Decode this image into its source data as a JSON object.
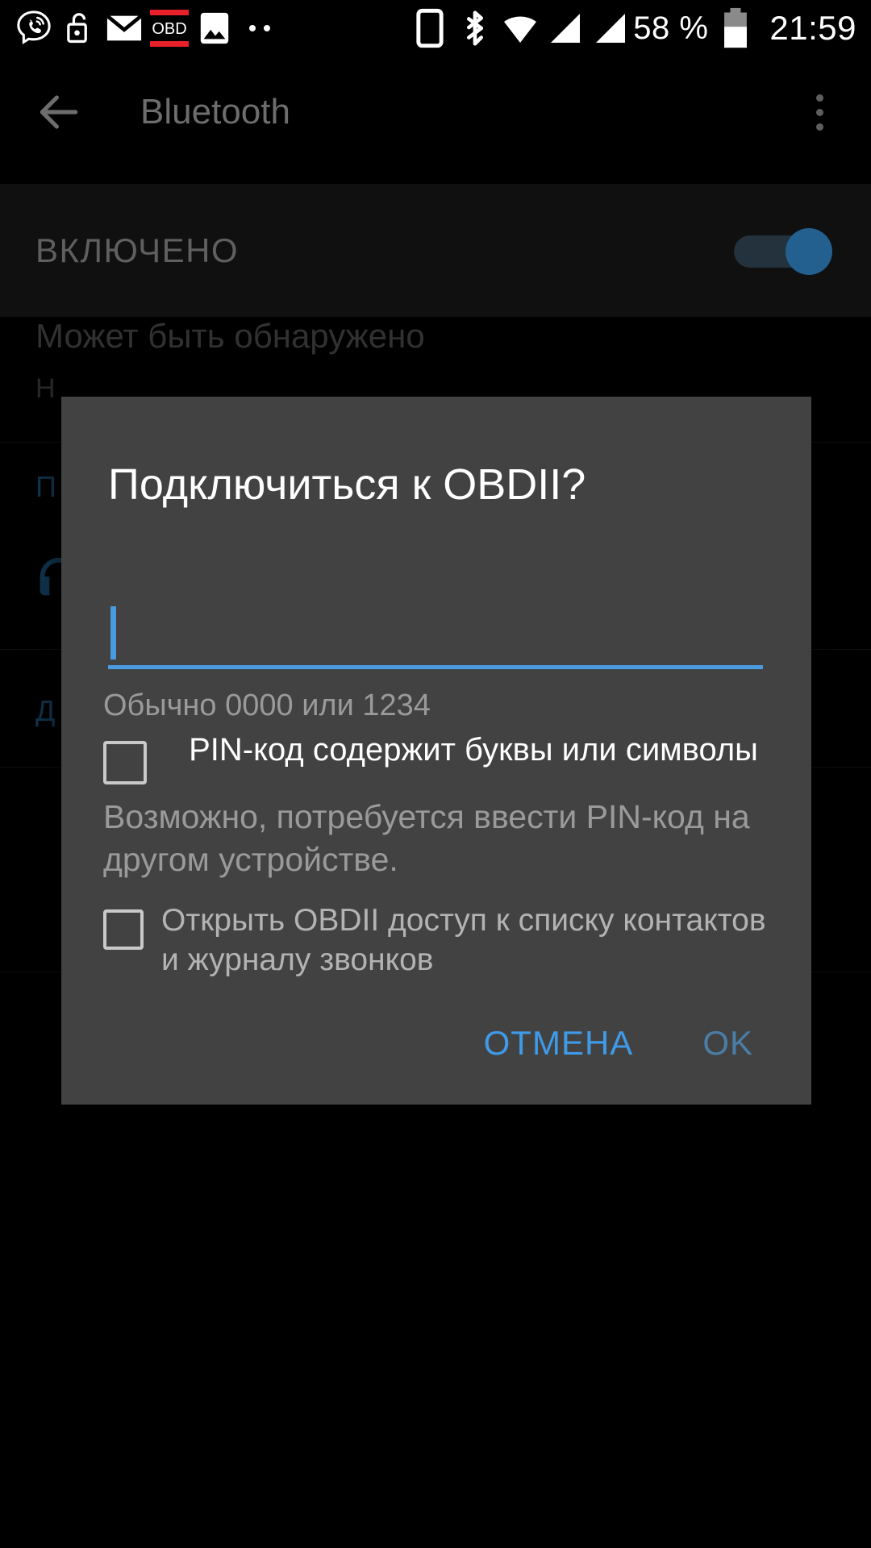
{
  "status_bar": {
    "time": "21:59",
    "battery_percent": "58 %",
    "icons": [
      {
        "name": "viber-icon",
        "label": "Viber"
      },
      {
        "name": "unlock-icon",
        "label": "Screen unlocked"
      },
      {
        "name": "email-icon",
        "label": "Email"
      },
      {
        "name": "obd-notification-icon",
        "label": "OBD"
      },
      {
        "name": "image-icon",
        "label": "Screenshot"
      },
      {
        "name": "more-notifications-icon",
        "label": "More notifications"
      },
      {
        "name": "phone-vibrate-icon",
        "label": "Device"
      },
      {
        "name": "bluetooth-icon",
        "label": "Bluetooth on"
      },
      {
        "name": "wifi-icon",
        "label": "Wi-Fi"
      },
      {
        "name": "signal-sim1-icon",
        "label": "SIM 1 signal"
      },
      {
        "name": "signal-sim2-icon",
        "label": "SIM 2 signal"
      },
      {
        "name": "battery-icon",
        "label": "Battery"
      }
    ],
    "obd_badge_text": "OBD"
  },
  "app_bar": {
    "title": "Bluetooth",
    "back_label": "Back",
    "overflow_label": "More options"
  },
  "enabled_row": {
    "label": "ВКЛЮЧЕНО",
    "switch_state": "on"
  },
  "background": {
    "discoverable_title": "Может быть обнаружено",
    "discoverable_subtitle": "Н",
    "paired_header": "П",
    "device_name_partial": "",
    "available_header": "Д"
  },
  "dialog": {
    "title": "Подключиться к OBDII?",
    "pin_input_value": "",
    "pin_input_placeholder": "",
    "pin_hint": "Обычно 0000 или 1234",
    "checkbox_alphanumeric": {
      "label": "PIN-код содержит буквы или символы",
      "checked": false
    },
    "note": "Возможно, потребуется ввести PIN-код на другом устройстве.",
    "checkbox_contacts": {
      "label": "Открыть OBDII доступ к списку контактов и журналу звонков",
      "checked": false
    },
    "cancel_label": "ОТМЕНА",
    "ok_label": "OK"
  },
  "colors": {
    "accent_blue": "#3f9ae8",
    "accent_blue_disabled": "#4a7ea6",
    "input_underline": "#4a9ae0",
    "dialog_bg": "#424242",
    "switch_on": "#23608f",
    "obd_red": "#e8202a"
  }
}
